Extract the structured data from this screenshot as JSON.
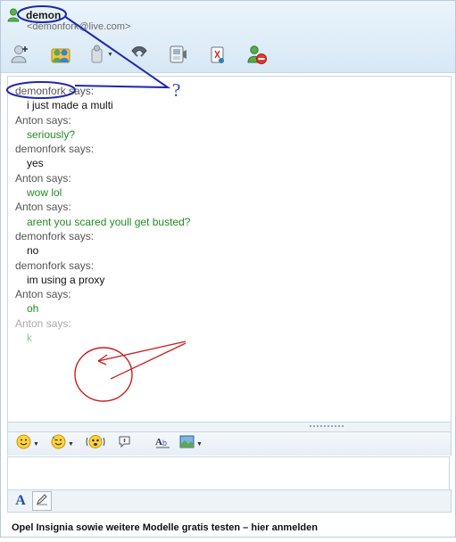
{
  "contact": {
    "name": "demon",
    "email": "<demonfork@live.com>"
  },
  "toolbar": {
    "buttons": [
      {
        "name": "invite-contact",
        "icon": "add-person-icon"
      },
      {
        "name": "share-folders",
        "icon": "shared-folder-icon"
      },
      {
        "name": "send-files",
        "icon": "send-file-icon"
      },
      {
        "name": "call",
        "icon": "phone-icon"
      },
      {
        "name": "video-call",
        "icon": "video-icon"
      },
      {
        "name": "games",
        "icon": "games-icon"
      },
      {
        "name": "block",
        "icon": "block-person-icon"
      }
    ]
  },
  "messages": [
    {
      "sender": "demonfork",
      "says": "says:",
      "text": "i just made a multi",
      "self": true
    },
    {
      "sender": "Anton",
      "says": "says:",
      "text": "seriously?",
      "self": false
    },
    {
      "sender": "demonfork",
      "says": "says:",
      "text": "yes",
      "self": true
    },
    {
      "sender": "Anton",
      "says": "says:",
      "text": "wow lol",
      "self": false
    },
    {
      "sender": "Anton",
      "says": "says:",
      "text": "arent you scared youll get busted?",
      "self": false
    },
    {
      "sender": "demonfork",
      "says": "says:",
      "text": "no",
      "self": true
    },
    {
      "sender": "demonfork",
      "says": "says:",
      "text": "im using a proxy",
      "self": true
    },
    {
      "sender": "Anton",
      "says": "says:",
      "text": "oh",
      "self": false
    },
    {
      "sender": "Anton",
      "says": "says:",
      "text": "k",
      "self": false,
      "fading": true
    }
  ],
  "format_toolbar": {
    "buttons": [
      {
        "name": "emoticons",
        "icon": "smiley-icon",
        "dropdown": true
      },
      {
        "name": "winks",
        "icon": "wink-icon",
        "dropdown": true
      },
      {
        "name": "nudge",
        "icon": "nudge-icon",
        "dropdown": false
      },
      {
        "name": "voice-clip",
        "icon": "voice-clip-icon",
        "dropdown": false
      },
      {
        "name": "font",
        "icon": "font-icon",
        "dropdown": false
      },
      {
        "name": "background",
        "icon": "background-icon",
        "dropdown": true
      }
    ]
  },
  "input": {
    "value": "",
    "placeholder": ""
  },
  "edit_tabs": {
    "text_label": "A",
    "handwriting": "pen-icon"
  },
  "ad": {
    "text": "Opel Insignia sowie weitere Modelle gratis testen – hier anmelden"
  },
  "annotations": {
    "question_mark": "?",
    "ink_blue": "#1f27b0",
    "ink_red": "#c81e1e"
  },
  "colors": {
    "self_text": "#111111",
    "contact_text": "#238b23",
    "header_bg": "#dcebf6"
  }
}
